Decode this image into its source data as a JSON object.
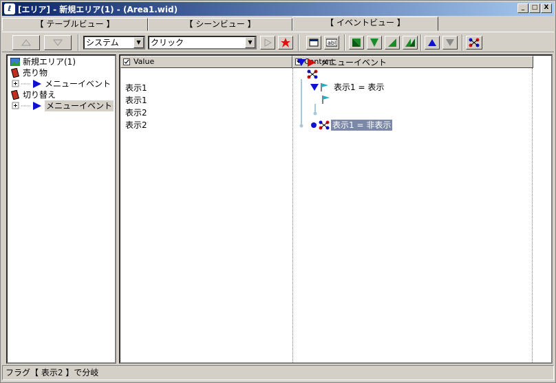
{
  "window": {
    "title": "[エリア] - 新規エリア(1) - (Area1.wid)",
    "minimize": "_",
    "maximize": "□",
    "close": "X"
  },
  "tabs": [
    {
      "label": "【 テーブルビュー 】",
      "active": false
    },
    {
      "label": "【 シーンビュー 】",
      "active": false
    },
    {
      "label": "【 イベントビュー 】",
      "active": true
    }
  ],
  "toolbar": {
    "category_select": "システム",
    "action_select": "クリック"
  },
  "tree": {
    "items": [
      {
        "label": "新規エリア(1)",
        "icon": "area-map-icon"
      },
      {
        "label": "売り物",
        "icon": "book-red-icon"
      },
      {
        "label": "メニューイベント",
        "icon": "blue-triangle-icon"
      },
      {
        "label": "切り替え",
        "icon": "book-red-icon"
      },
      {
        "label": "メニューイベント",
        "icon": "blue-triangle-icon"
      }
    ]
  },
  "grid": {
    "value_header": "Value",
    "content_header": "Content",
    "values": [
      "表示1",
      "表示1",
      "表示2",
      "表示2"
    ],
    "content": [
      {
        "label": "メニューイベント"
      },
      {
        "label": "表示1 = 表示"
      },
      {
        "label": "表示1 = 非表示"
      }
    ]
  },
  "status": {
    "text": "フラグ【 表示2 】で分岐"
  },
  "colors": {
    "title_start": "#0a246a",
    "title_end": "#a6caf0",
    "selection": "#7b88a8",
    "accent_green": "#1a8a2a",
    "accent_blue": "#1010d0",
    "accent_red": "#d01010"
  }
}
